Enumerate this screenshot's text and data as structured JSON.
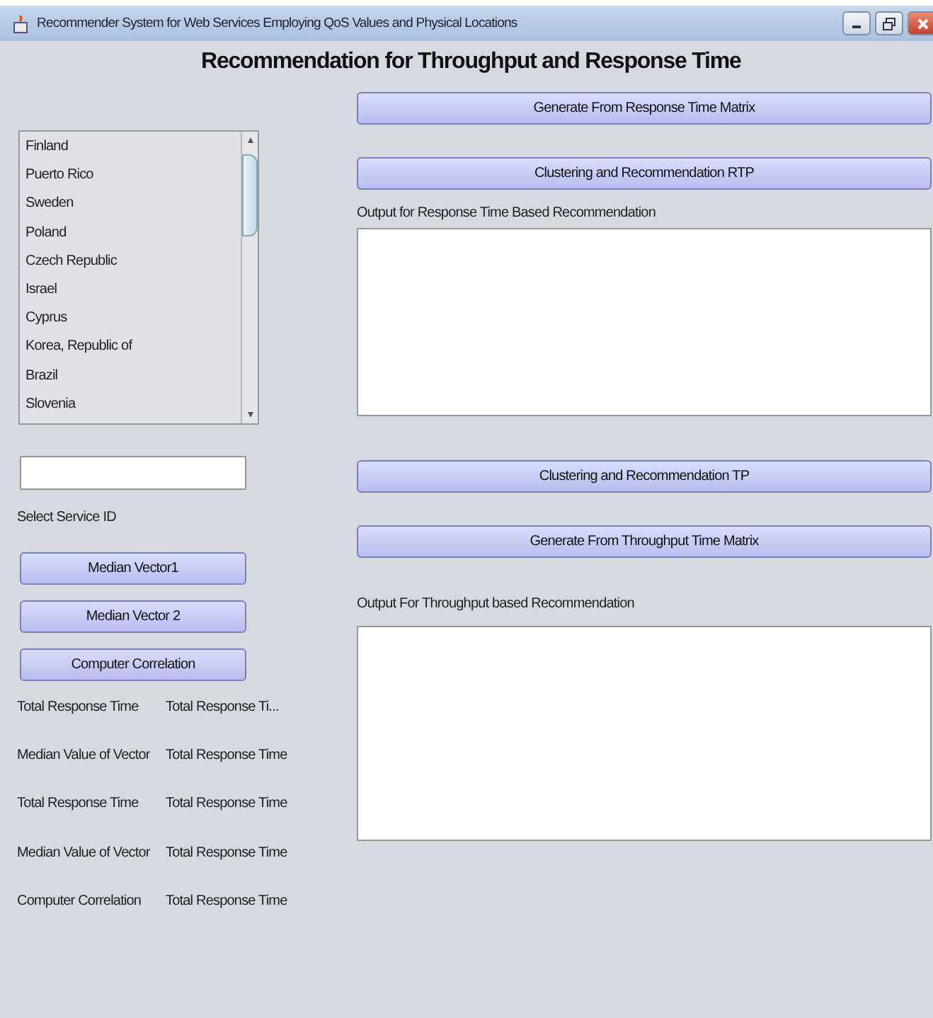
{
  "window": {
    "title": "Recommender System for Web Services Employing QoS Values and Physical Locations"
  },
  "heading": "Recommendation for Throughput and Response Time",
  "country_list": [
    "Finland",
    "Puerto Rico",
    "Sweden",
    "Poland",
    "Czech Republic",
    "Israel",
    "Cyprus",
    "Korea, Republic of",
    "Brazil",
    "Slovenia"
  ],
  "service_id_field": {
    "label": "Select Service ID"
  },
  "left_buttons": [
    "Median Vector1",
    "Median Vector 2",
    "Computer Correlation"
  ],
  "results": [
    {
      "label": "Total Response Time",
      "value": "Total Response Ti..."
    },
    {
      "label": "Median Value of Vector",
      "value": "Total Response Time"
    },
    {
      "label": "Total Response Time",
      "value": "Total Response Time"
    },
    {
      "label": "Median Value of Vector",
      "value": "Total Response Time"
    },
    {
      "label": "Computer Correlation",
      "value": "Total Response Time"
    }
  ],
  "response_section": {
    "buttons": [
      "Generate From Response Time Matrix",
      "Clustering and Recommendation RTP"
    ],
    "output_label": "Output for Response Time Based Recommendation"
  },
  "throughput_section": {
    "buttons": [
      "Clustering and Recommendation TP",
      "Generate From Throughput Time Matrix"
    ],
    "output_label": "Output For Throughput based Recommendation"
  }
}
